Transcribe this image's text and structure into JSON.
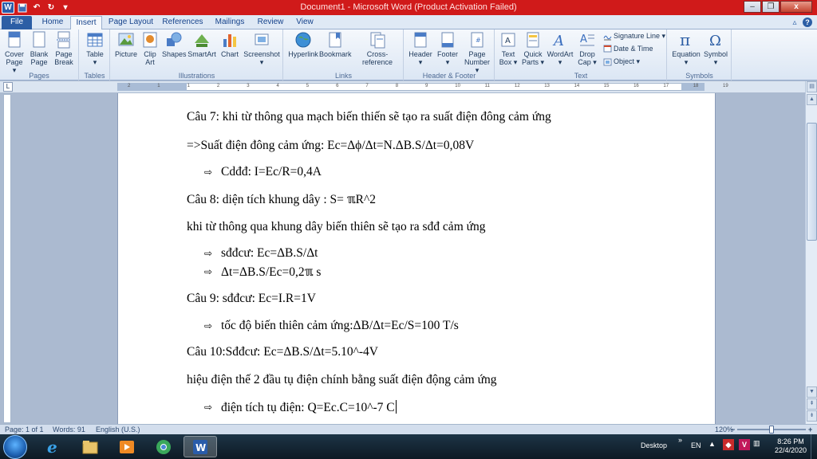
{
  "window": {
    "title": "Document1  -  Microsoft Word (Product Activation Failed)",
    "minimize": "–",
    "restore": "❐",
    "close": "x"
  },
  "qat": {
    "app": "W",
    "save": "💾",
    "undo": "↶",
    "redo": "↻",
    "more": "▾"
  },
  "tabs": [
    {
      "label": "File"
    },
    {
      "label": "Home"
    },
    {
      "label": "Insert"
    },
    {
      "label": "Page Layout"
    },
    {
      "label": "References"
    },
    {
      "label": "Mailings"
    },
    {
      "label": "Review"
    },
    {
      "label": "View"
    }
  ],
  "ribbon": {
    "pages": {
      "label": "Pages",
      "cover": "Cover\nPage ▾",
      "blank": "Blank\nPage",
      "break": "Page\nBreak"
    },
    "tables": {
      "label": "Tables",
      "table": "Table\n▾"
    },
    "illustrations": {
      "label": "Illustrations",
      "picture": "Picture",
      "clipart": "Clip\nArt",
      "shapes": "Shapes",
      "smartart": "SmartArt",
      "chart": "Chart",
      "screenshot": "Screenshot\n▾"
    },
    "links": {
      "label": "Links",
      "hyperlink": "Hyperlink",
      "bookmark": "Bookmark",
      "crossref": "Cross-reference"
    },
    "headerfooter": {
      "label": "Header & Footer",
      "header": "Header\n▾",
      "footer": "Footer\n▾",
      "pagenumber": "Page\nNumber ▾"
    },
    "text": {
      "label": "Text",
      "textbox": "Text\nBox ▾",
      "quickparts": "Quick\nParts ▾",
      "wordart": "WordArt\n▾",
      "dropcap": "Drop\nCap ▾",
      "signature": "Signature Line ▾",
      "datetime": "Date & Time",
      "object": "Object ▾"
    },
    "symbols": {
      "label": "Symbols",
      "equation": "Equation\n▾",
      "symbol": "Symbol\n▾"
    }
  },
  "ruler": {
    "corner": "L",
    "numbers": [
      "2",
      "1",
      "1",
      "2",
      "3",
      "4",
      "5",
      "6",
      "7",
      "8",
      "9",
      "10",
      "11",
      "12",
      "13",
      "14",
      "15",
      "16",
      "17",
      "18",
      "19"
    ]
  },
  "document": {
    "lines": [
      "Câu 7: khi từ thông qua mạch biến thiến sẽ tạo ra suất điện đông cảm ứng",
      "=>Suất điện đông cảm ứng: Ec=Δϕ/Δt=N.ΔB.S/Δt=0,08V",
      "Cdđđ: I=Ec/R=0,4A",
      "Câu 8: diện tích khung dây : S= ℼR^2",
      "khi từ thông qua khung dây biến thiên sẽ tạo ra sđđ cảm ứng",
      "sđđcư: Ec=ΔB.S/Δt",
      "Δt=ΔB.S/Ec=0,2ℼ s",
      "Câu 9: sđđcư: Ec=I.R=1V",
      "tốc độ biến thiên cảm ứng:ΔB/Δt=Ec/S=100  T/s",
      "Câu 10:Sđđcư: Ec=ΔB.S/Δt=5.10^-4V",
      "hiệu điện thế 2 đầu tụ điện chính bằng suất điện động cảm ứng",
      "điện tích tụ điện: Q=Ec.C=10^-7  C"
    ],
    "bullet_glyph": "⇨"
  },
  "statusbar": {
    "page": "Page: 1 of 1",
    "words": "Words: 91",
    "language": "English (U.S.)",
    "zoom": "120%",
    "zoom_minus": "−",
    "zoom_plus": "+",
    "zoom_fraction": 0.5
  },
  "taskbar": {
    "desktop_label": "Desktop",
    "chevron": "»",
    "lang": "EN",
    "time": "8:26 PM",
    "date": "22/4/2020"
  },
  "colors": {
    "titlebar": "#d01a1a",
    "file_tab": "#2c5ea5",
    "ribbon": "#dbe6f4"
  }
}
